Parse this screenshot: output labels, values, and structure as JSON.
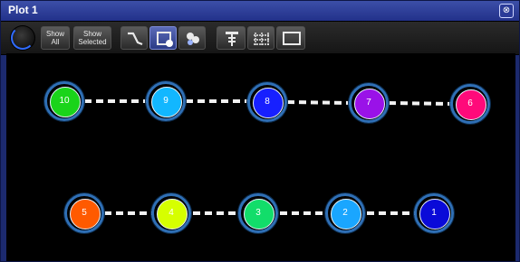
{
  "window": {
    "title": "Plot 1",
    "close_glyph": "⊗"
  },
  "toolbar": {
    "show_all": {
      "line1": "Show",
      "line2": "All"
    },
    "show_selected": {
      "line1": "Show",
      "line2": "Selected"
    },
    "tools": [
      {
        "name": "curve-tool-icon"
      },
      {
        "name": "select-fixture-icon",
        "active": true
      },
      {
        "name": "move-fixtures-icon"
      },
      {
        "name": "truss-tool-icon"
      },
      {
        "name": "grid-icon"
      },
      {
        "name": "rectangle-icon"
      }
    ]
  },
  "fixtures": [
    {
      "label": "10",
      "color": "#1ad41a"
    },
    {
      "label": "9",
      "color": "#12b7ff"
    },
    {
      "label": "8",
      "color": "#1720ff"
    },
    {
      "label": "7",
      "color": "#9a12e8"
    },
    {
      "label": "6",
      "color": "#ff0a7a"
    },
    {
      "label": "5",
      "color": "#ff5a00"
    },
    {
      "label": "4",
      "color": "#d6ff00"
    },
    {
      "label": "3",
      "color": "#12dd6a"
    },
    {
      "label": "2",
      "color": "#1aa6ff"
    },
    {
      "label": "1",
      "color": "#0a0ad8"
    }
  ]
}
